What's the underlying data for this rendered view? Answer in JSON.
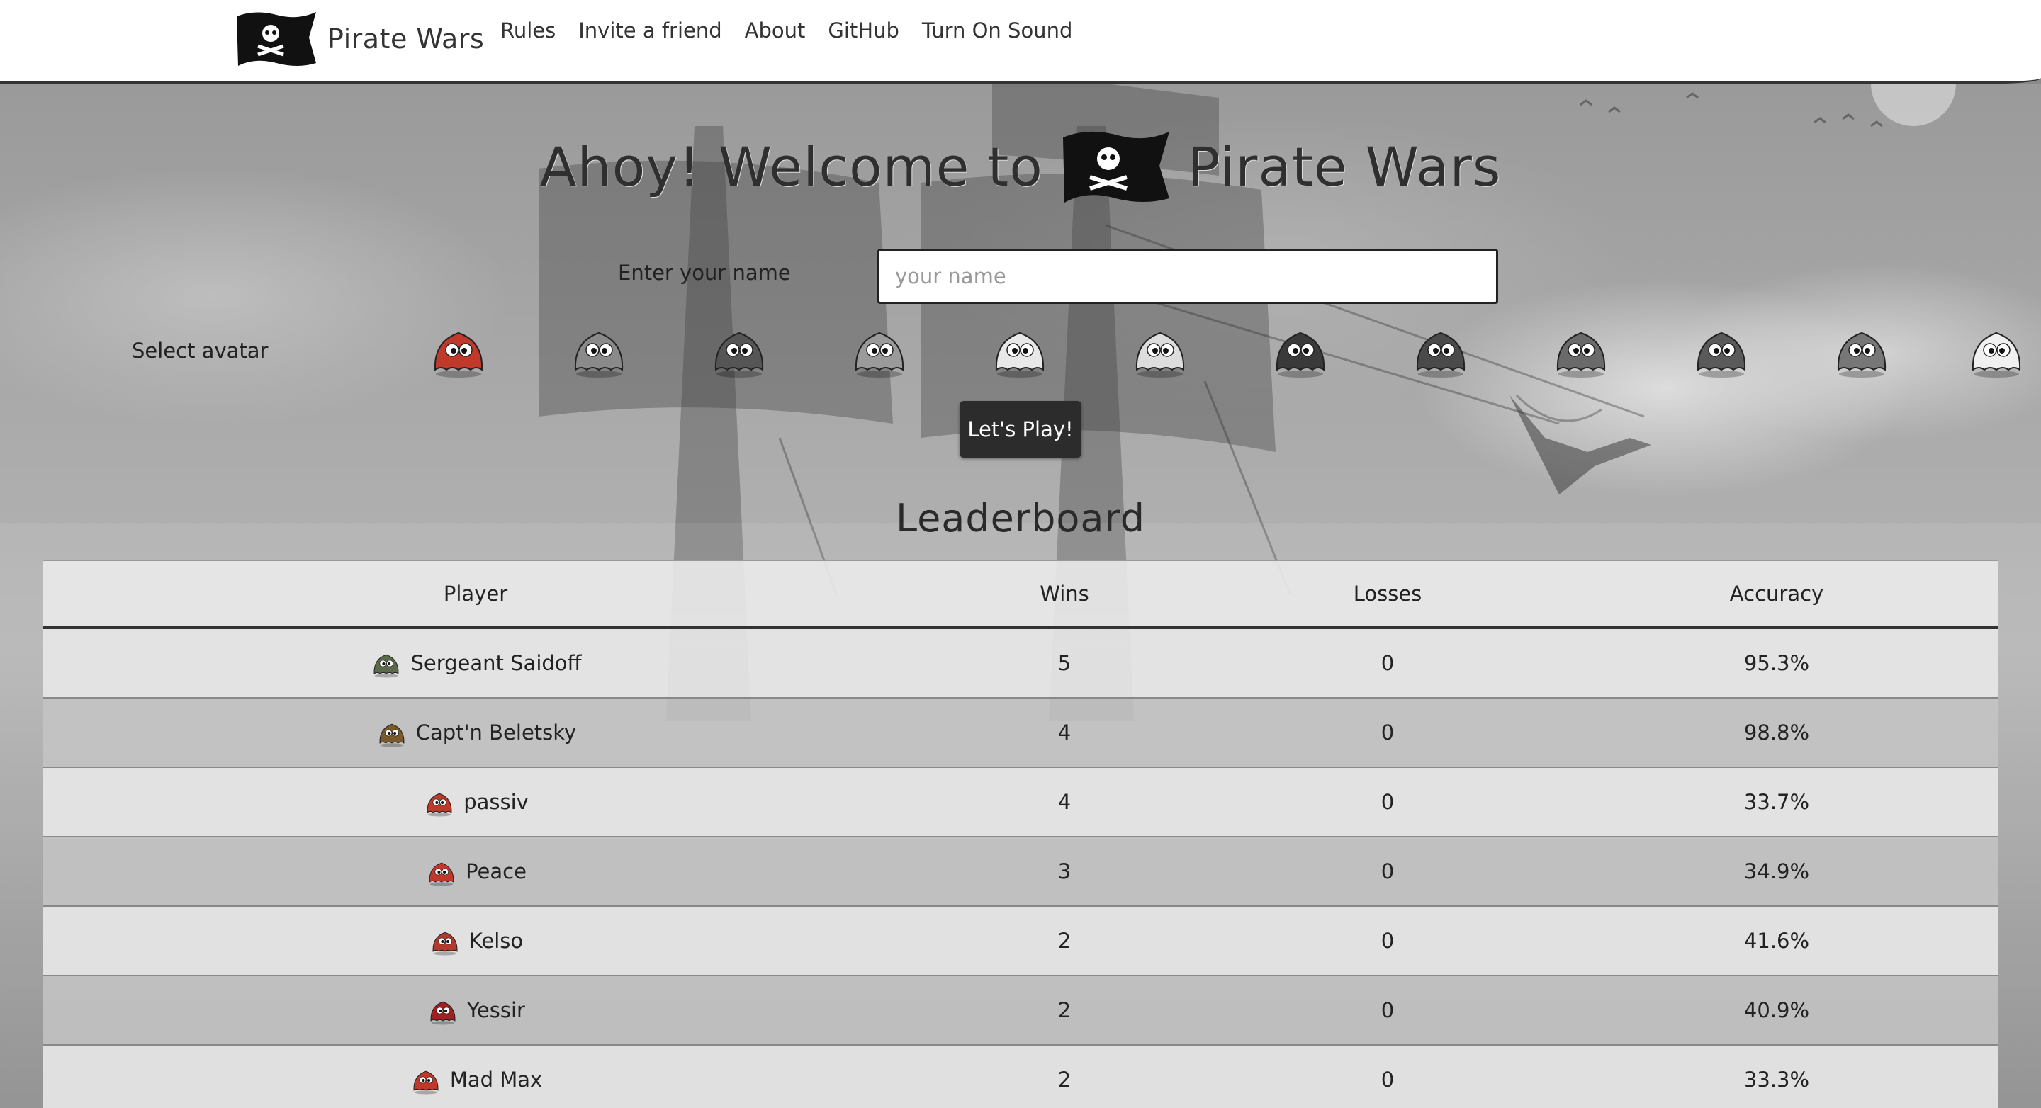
{
  "navbar": {
    "brand": "Pirate Wars",
    "links": [
      {
        "label": "Rules"
      },
      {
        "label": "Invite a friend"
      },
      {
        "label": "About"
      },
      {
        "label": "GitHub"
      },
      {
        "label": "Turn On Sound"
      }
    ]
  },
  "hero": {
    "title_left": "Ahoy! Welcome to",
    "title_right": "Pirate Wars"
  },
  "form": {
    "name_label": "Enter your name",
    "name_placeholder": "your name",
    "name_value": "",
    "avatar_label": "Select avatar",
    "avatars": [
      {
        "icon": "pirate-bandana-avatar-icon",
        "color": "#c0392b"
      },
      {
        "icon": "gray-ghost-avatar-icon",
        "color": "#8a8a8a"
      },
      {
        "icon": "dark-bot-avatar-icon",
        "color": "#555555"
      },
      {
        "icon": "fish-avatar-icon",
        "color": "#9a9a9a"
      },
      {
        "icon": "chef-avatar-icon",
        "color": "#e8e8e8"
      },
      {
        "icon": "white-monster-avatar-icon",
        "color": "#dddddd"
      },
      {
        "icon": "black-monster-avatar-icon",
        "color": "#3a3a3a"
      },
      {
        "icon": "ninja-avatar-icon",
        "color": "#4a4a4a"
      },
      {
        "icon": "captain-avatar-icon",
        "color": "#6a6a6a"
      },
      {
        "icon": "horned-monster-avatar-icon",
        "color": "#5a5a5a"
      },
      {
        "icon": "cow-monster-avatar-icon",
        "color": "#777777"
      },
      {
        "icon": "sword-ghost-avatar-icon",
        "color": "#f0f0f0"
      }
    ],
    "play_button": "Let's Play!"
  },
  "leaderboard": {
    "title": "Leaderboard",
    "columns": [
      "Player",
      "Wins",
      "Losses",
      "Accuracy"
    ],
    "rows": [
      {
        "player": "Sergeant Saidoff",
        "wins": "5",
        "losses": "0",
        "accuracy": "95.3%",
        "avatar_icon": "soldier-avatar-icon",
        "color": "#5a6a4a"
      },
      {
        "player": "Capt'n Beletsky",
        "wins": "4",
        "losses": "0",
        "accuracy": "98.8%",
        "avatar_icon": "captain-avatar-icon",
        "color": "#7a5a2a"
      },
      {
        "player": "passiv",
        "wins": "4",
        "losses": "0",
        "accuracy": "33.7%",
        "avatar_icon": "pirate-bandana-avatar-icon",
        "color": "#c0392b"
      },
      {
        "player": "Peace",
        "wins": "3",
        "losses": "0",
        "accuracy": "34.9%",
        "avatar_icon": "horned-monster-avatar-icon",
        "color": "#c0392b"
      },
      {
        "player": "Kelso",
        "wins": "2",
        "losses": "0",
        "accuracy": "41.6%",
        "avatar_icon": "cow-monster-avatar-icon",
        "color": "#b03a2e"
      },
      {
        "player": "Yessir",
        "wins": "2",
        "losses": "0",
        "accuracy": "40.9%",
        "avatar_icon": "black-monster-avatar-icon",
        "color": "#a02020"
      },
      {
        "player": "Mad Max",
        "wins": "2",
        "losses": "0",
        "accuracy": "33.3%",
        "avatar_icon": "dark-bot-avatar-icon",
        "color": "#c0392b"
      }
    ]
  }
}
